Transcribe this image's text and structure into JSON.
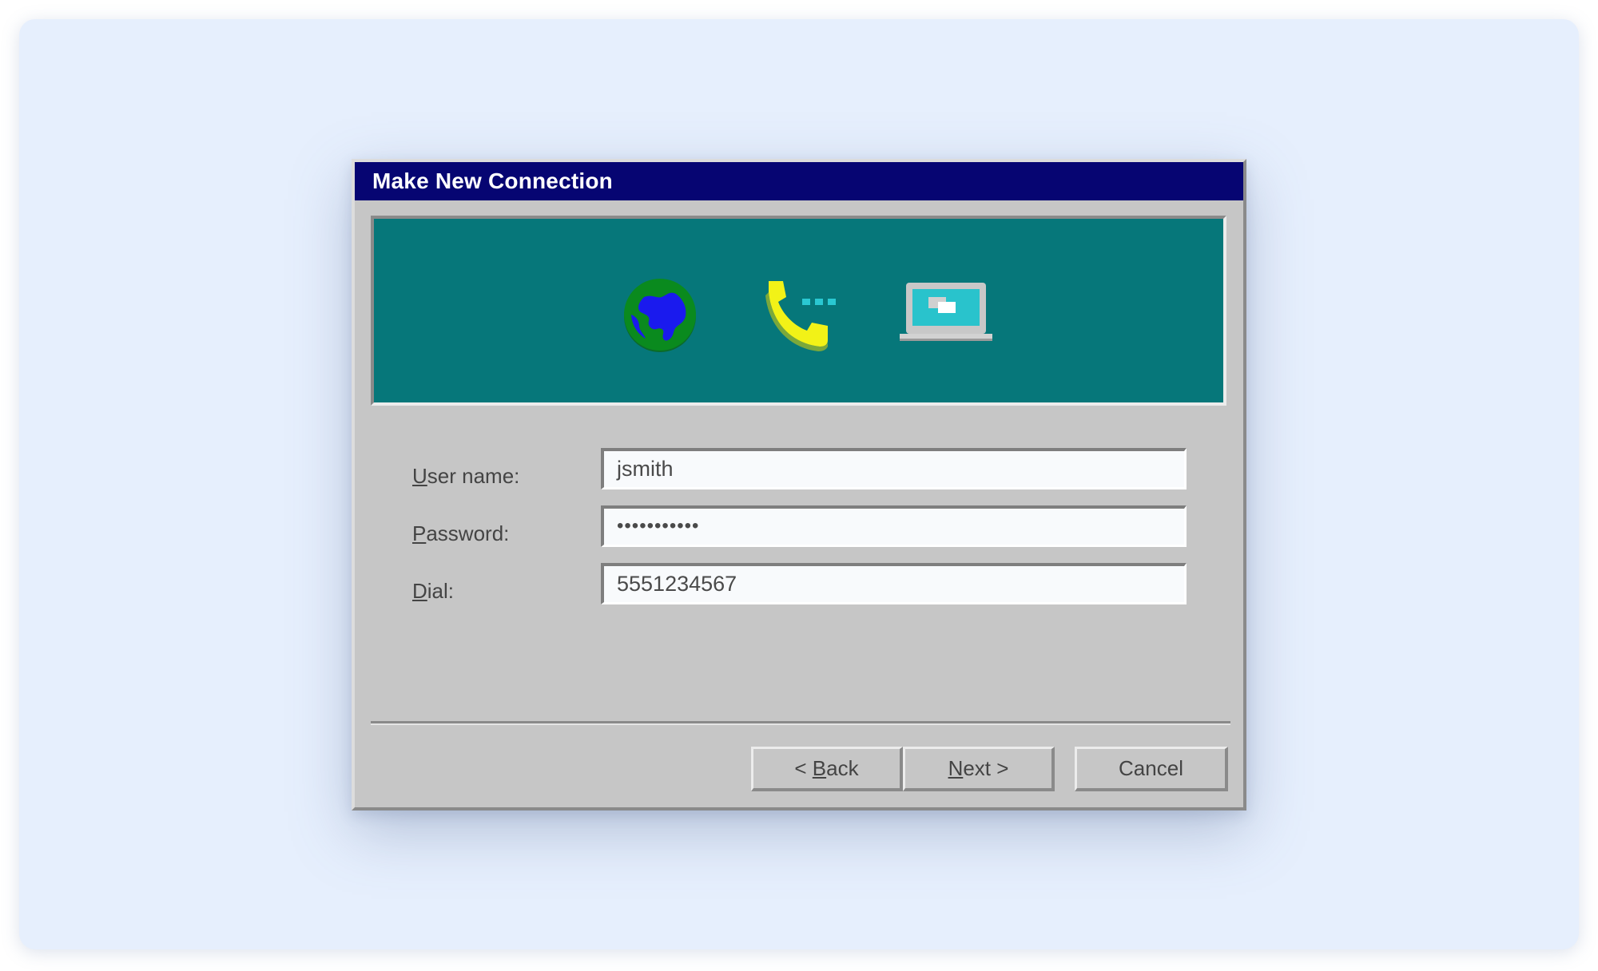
{
  "dialog": {
    "title": "Make New Connection"
  },
  "banner": {
    "icons": [
      "globe-icon",
      "phone-icon",
      "laptop-icon"
    ],
    "background_color": "#06777a"
  },
  "form": {
    "username": {
      "label_accel": "U",
      "label_rest": "ser name:",
      "value": "jsmith"
    },
    "password": {
      "label_accel": "P",
      "label_rest": "assword:",
      "value": "•••••••••••"
    },
    "dial": {
      "label_accel": "D",
      "label_rest": "ial:",
      "value": "5551234567"
    }
  },
  "buttons": {
    "back": {
      "prefix": "< ",
      "accel": "B",
      "rest": "ack"
    },
    "next": {
      "accel": "N",
      "rest": "ext >"
    },
    "cancel": {
      "label": "Cancel"
    }
  },
  "colors": {
    "titlebar": "#060572",
    "dialog_face": "#c6c6c6",
    "desktop": "#e6effd"
  }
}
